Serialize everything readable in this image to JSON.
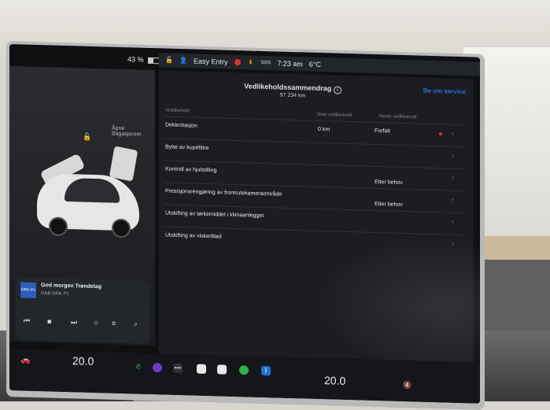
{
  "status_bar": {
    "battery": "43 %",
    "profile": "Easy Entry",
    "sos": "SOS",
    "time": "7:23 am",
    "temperature": "6°C"
  },
  "left_panel": {
    "trunk_label": "Åpne\nBagasjerom",
    "frunk_label": "Åpne"
  },
  "media": {
    "art_label": "NRK P1",
    "title": "God morgen Trøndelag",
    "station": "DAB NRK P1"
  },
  "main": {
    "title": "Vedlikeholdssammendrag",
    "odometer": "97 234  km",
    "schedule_link": "Be om service",
    "columns": {
      "item": "Vedlikehold",
      "last": "Siste vedlikehold",
      "next": "Neste vedlikehold"
    },
    "rows": [
      {
        "name": "Dekkrotasjon",
        "last": "0 km",
        "next": "Forfalt",
        "alert": true
      },
      {
        "name": "Bytte av kupéfiltre",
        "last": "",
        "next": "",
        "alert": false
      },
      {
        "name": "Kontroll av hjulstilling",
        "last": "",
        "next": "Etter behov",
        "alert": false
      },
      {
        "name": "Presisjonsrengjøring av frontrutekameraområde",
        "last": "",
        "next": "Etter behov",
        "alert": false
      },
      {
        "name": "Utskifting av tørkemiddel i klimaanlegget",
        "last": "",
        "next": "",
        "alert": false
      },
      {
        "name": "Utskifting av viskerblad",
        "last": "",
        "next": "",
        "alert": false
      }
    ]
  },
  "dock": {
    "driver_temp": "20.0",
    "passenger_temp": "20.0"
  },
  "colors": {
    "accent_blue": "#2a6fd8",
    "alert_red": "#e03030",
    "screen_bg": "#1c1d20"
  }
}
